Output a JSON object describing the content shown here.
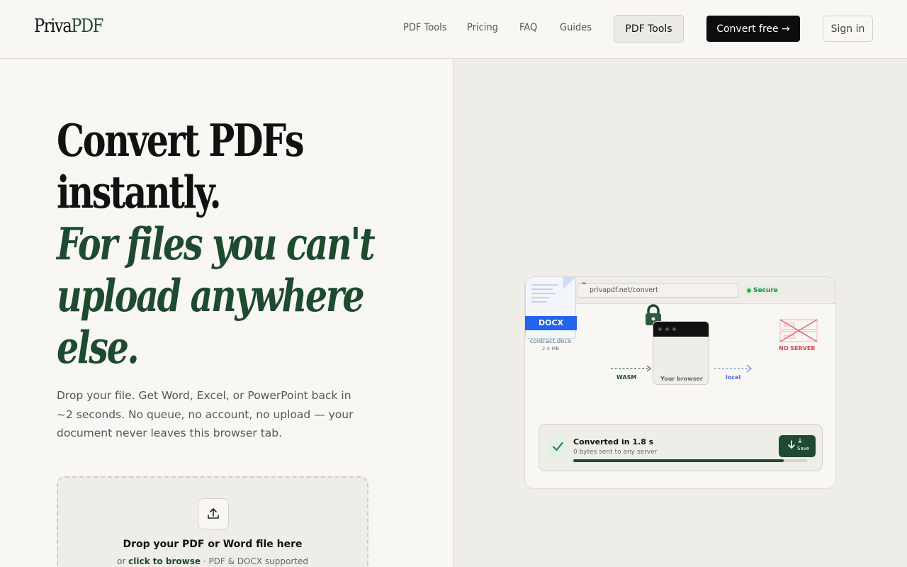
{
  "brand": {
    "name_prefix": "Priva",
    "name_suffix": "PDF"
  },
  "nav": {
    "links": [
      "PDF Tools",
      "Pricing",
      "FAQ",
      "Guides"
    ],
    "tools_button": "PDF Tools",
    "cta_button": "Convert free →",
    "signin_button": "Sign in"
  },
  "hero": {
    "headline_line1": "Convert PDFs",
    "headline_line2": "instantly.",
    "headline_italic1": "For files you can't",
    "headline_italic2": "upload anywhere",
    "headline_italic3": "else.",
    "lead": "Drop your file. Get Word, Excel, or PowerPoint back in ~2 seconds. No queue, no account, no upload — your document never leaves this browser tab."
  },
  "dropzone": {
    "title": "Drop your PDF or Word file here",
    "sub_prefix": "or ",
    "browse_link": "click to browse",
    "sub_suffix": " · PDF & DOCX supported",
    "icon": "upload-icon"
  },
  "illustration": {
    "url": "privapdf.net/convert",
    "secure_label": "Secure",
    "doc_badge": "DOCX",
    "doc_name": "contract.docx",
    "doc_size": "2.4 MB",
    "browser_label": "Your browser",
    "wasm_label": "WASM",
    "local_label": "local",
    "noserver_label": "NO SERVER",
    "result_title": "Converted in 1.8 s",
    "result_sub": "0 bytes sent to any server",
    "progress": 0.9,
    "save_label": "Save"
  },
  "colors": {
    "accent_green": "#1e4a30",
    "docx_blue": "#2563eb",
    "secure_green": "#22b34a",
    "no_server_red": "#d6454a"
  }
}
